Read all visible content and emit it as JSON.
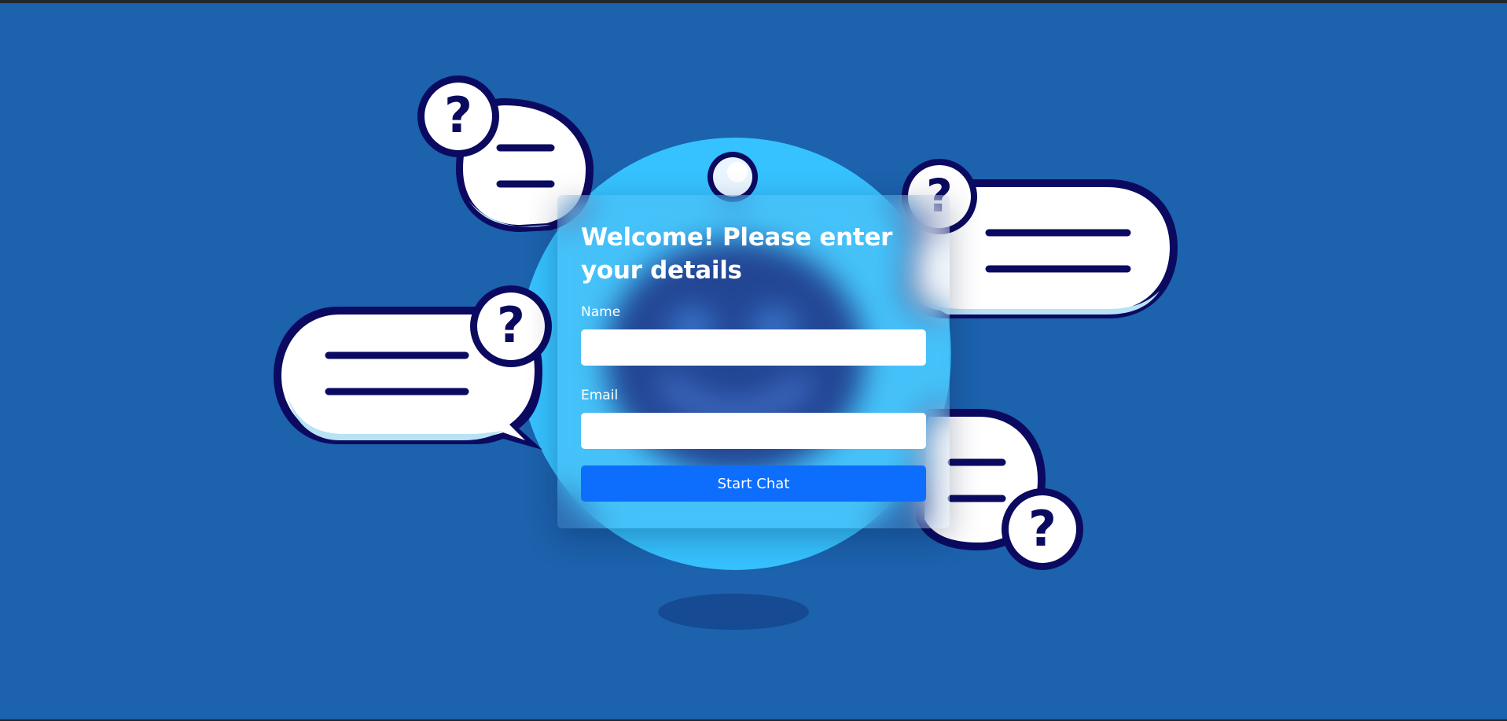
{
  "form": {
    "title": "Welcome! Please enter your details",
    "name_label": "Name",
    "name_value": "",
    "email_label": "Email",
    "email_value": "",
    "submit_label": "Start Chat"
  },
  "colors": {
    "background": "#1c62ad",
    "robot_head": "#36c2fe",
    "bubble_outline": "#0b0a60",
    "bubble_fill": "#ffffff",
    "button": "#0d6efd"
  }
}
